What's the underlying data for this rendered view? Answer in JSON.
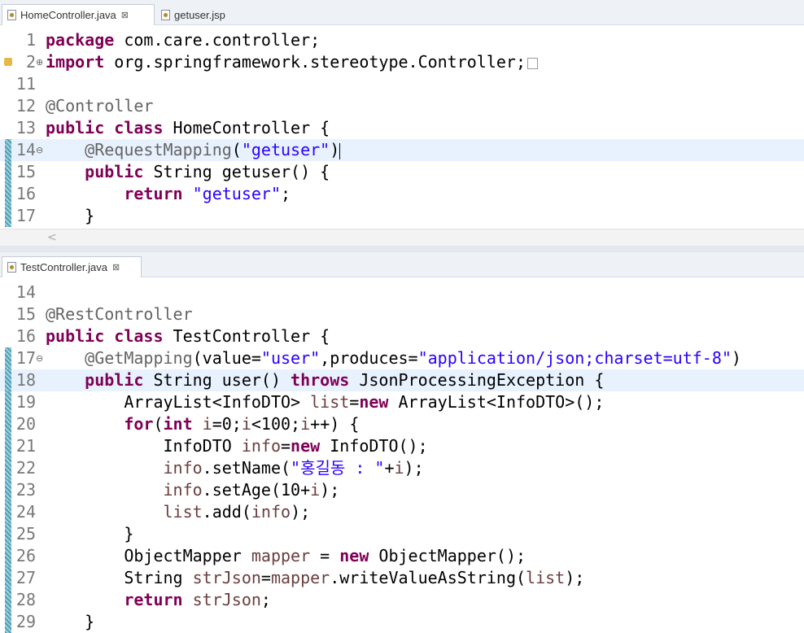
{
  "top_editor": {
    "tabs": [
      {
        "label": "HomeController.java",
        "close": "⊠"
      },
      {
        "label": "getuser.jsp"
      }
    ],
    "lines": [
      {
        "num": "1",
        "tokens": [
          {
            "t": "package",
            "c": "kw"
          },
          {
            "t": " com.care.controller;"
          }
        ]
      },
      {
        "num": "2",
        "tokens": [
          {
            "t": "import",
            "c": "kw"
          },
          {
            "t": " org.springframework.stereotype.Controller;"
          }
        ]
      },
      {
        "num": "11",
        "tokens": []
      },
      {
        "num": "12",
        "tokens": [
          {
            "t": "@Controller",
            "c": "ann"
          }
        ]
      },
      {
        "num": "13",
        "tokens": [
          {
            "t": "public",
            "c": "kw"
          },
          {
            "t": " "
          },
          {
            "t": "class",
            "c": "kw"
          },
          {
            "t": " HomeController {"
          }
        ]
      },
      {
        "num": "14",
        "tokens": [
          {
            "t": "    "
          },
          {
            "t": "@RequestMapping",
            "c": "ann"
          },
          {
            "t": "("
          },
          {
            "t": "\"getuser\"",
            "c": "str"
          },
          {
            "t": ")"
          }
        ]
      },
      {
        "num": "15",
        "tokens": [
          {
            "t": "    "
          },
          {
            "t": "public",
            "c": "kw"
          },
          {
            "t": " String getuser() {"
          }
        ]
      },
      {
        "num": "16",
        "tokens": [
          {
            "t": "        "
          },
          {
            "t": "return",
            "c": "kw"
          },
          {
            "t": " "
          },
          {
            "t": "\"getuser\"",
            "c": "str"
          },
          {
            "t": ";"
          }
        ]
      },
      {
        "num": "17",
        "tokens": [
          {
            "t": "    }"
          }
        ]
      }
    ]
  },
  "bottom_editor": {
    "tabs": [
      {
        "label": "TestController.java",
        "close": "⊠"
      }
    ],
    "lines": [
      {
        "num": "14",
        "tokens": []
      },
      {
        "num": "15",
        "tokens": [
          {
            "t": "@RestController",
            "c": "ann"
          }
        ]
      },
      {
        "num": "16",
        "tokens": [
          {
            "t": "public",
            "c": "kw"
          },
          {
            "t": " "
          },
          {
            "t": "class",
            "c": "kw"
          },
          {
            "t": " TestController {"
          }
        ]
      },
      {
        "num": "17",
        "tokens": [
          {
            "t": "    "
          },
          {
            "t": "@GetMapping",
            "c": "ann"
          },
          {
            "t": "(value="
          },
          {
            "t": "\"user\"",
            "c": "str"
          },
          {
            "t": ",produces="
          },
          {
            "t": "\"application/json;charset=utf-8\"",
            "c": "str"
          },
          {
            "t": ")"
          }
        ]
      },
      {
        "num": "18",
        "tokens": [
          {
            "t": "    "
          },
          {
            "t": "public",
            "c": "kw"
          },
          {
            "t": " String user() "
          },
          {
            "t": "throws",
            "c": "kw"
          },
          {
            "t": " JsonProcessingException {"
          }
        ]
      },
      {
        "num": "19",
        "tokens": [
          {
            "t": "        ArrayList<InfoDTO> "
          },
          {
            "t": "list",
            "c": "var"
          },
          {
            "t": "="
          },
          {
            "t": "new",
            "c": "kw"
          },
          {
            "t": " ArrayList<InfoDTO>();"
          }
        ]
      },
      {
        "num": "20",
        "tokens": [
          {
            "t": "        "
          },
          {
            "t": "for",
            "c": "kw"
          },
          {
            "t": "("
          },
          {
            "t": "int",
            "c": "kw"
          },
          {
            "t": " "
          },
          {
            "t": "i",
            "c": "var"
          },
          {
            "t": "=0;"
          },
          {
            "t": "i",
            "c": "var"
          },
          {
            "t": "<100;"
          },
          {
            "t": "i",
            "c": "var"
          },
          {
            "t": "++) {"
          }
        ]
      },
      {
        "num": "21",
        "tokens": [
          {
            "t": "            InfoDTO "
          },
          {
            "t": "info",
            "c": "var"
          },
          {
            "t": "="
          },
          {
            "t": "new",
            "c": "kw"
          },
          {
            "t": " InfoDTO();"
          }
        ]
      },
      {
        "num": "22",
        "tokens": [
          {
            "t": "            "
          },
          {
            "t": "info",
            "c": "var"
          },
          {
            "t": ".setName("
          },
          {
            "t": "\"홍길동 : \"",
            "c": "str"
          },
          {
            "t": "+"
          },
          {
            "t": "i",
            "c": "var"
          },
          {
            "t": ");"
          }
        ]
      },
      {
        "num": "23",
        "tokens": [
          {
            "t": "            "
          },
          {
            "t": "info",
            "c": "var"
          },
          {
            "t": ".setAge(10+"
          },
          {
            "t": "i",
            "c": "var"
          },
          {
            "t": ");"
          }
        ]
      },
      {
        "num": "24",
        "tokens": [
          {
            "t": "            "
          },
          {
            "t": "list",
            "c": "var"
          },
          {
            "t": ".add("
          },
          {
            "t": "info",
            "c": "var"
          },
          {
            "t": ");"
          }
        ]
      },
      {
        "num": "25",
        "tokens": [
          {
            "t": "        }"
          }
        ]
      },
      {
        "num": "26",
        "tokens": [
          {
            "t": "        ObjectMapper "
          },
          {
            "t": "mapper",
            "c": "var"
          },
          {
            "t": " = "
          },
          {
            "t": "new",
            "c": "kw"
          },
          {
            "t": " ObjectMapper();"
          }
        ]
      },
      {
        "num": "27",
        "tokens": [
          {
            "t": "        String "
          },
          {
            "t": "strJson",
            "c": "var"
          },
          {
            "t": "="
          },
          {
            "t": "mapper",
            "c": "var"
          },
          {
            "t": ".writeValueAsString("
          },
          {
            "t": "list",
            "c": "var"
          },
          {
            "t": ");"
          }
        ]
      },
      {
        "num": "28",
        "tokens": [
          {
            "t": "        "
          },
          {
            "t": "return",
            "c": "kw"
          },
          {
            "t": " "
          },
          {
            "t": "strJson",
            "c": "var"
          },
          {
            "t": ";"
          }
        ]
      },
      {
        "num": "29",
        "tokens": [
          {
            "t": "    }"
          }
        ]
      }
    ]
  },
  "colors": {
    "keyword": "#7f0055",
    "annotation": "#646464",
    "string": "#2a00ff",
    "local_variable": "#6a3e3e",
    "current_line": "#e8f2fe"
  },
  "icons": [
    "java-file-icon",
    "jsp-file-icon",
    "close-tab-icon",
    "fold-icon",
    "warning-icon",
    "scroll-left-arrow-icon"
  ]
}
